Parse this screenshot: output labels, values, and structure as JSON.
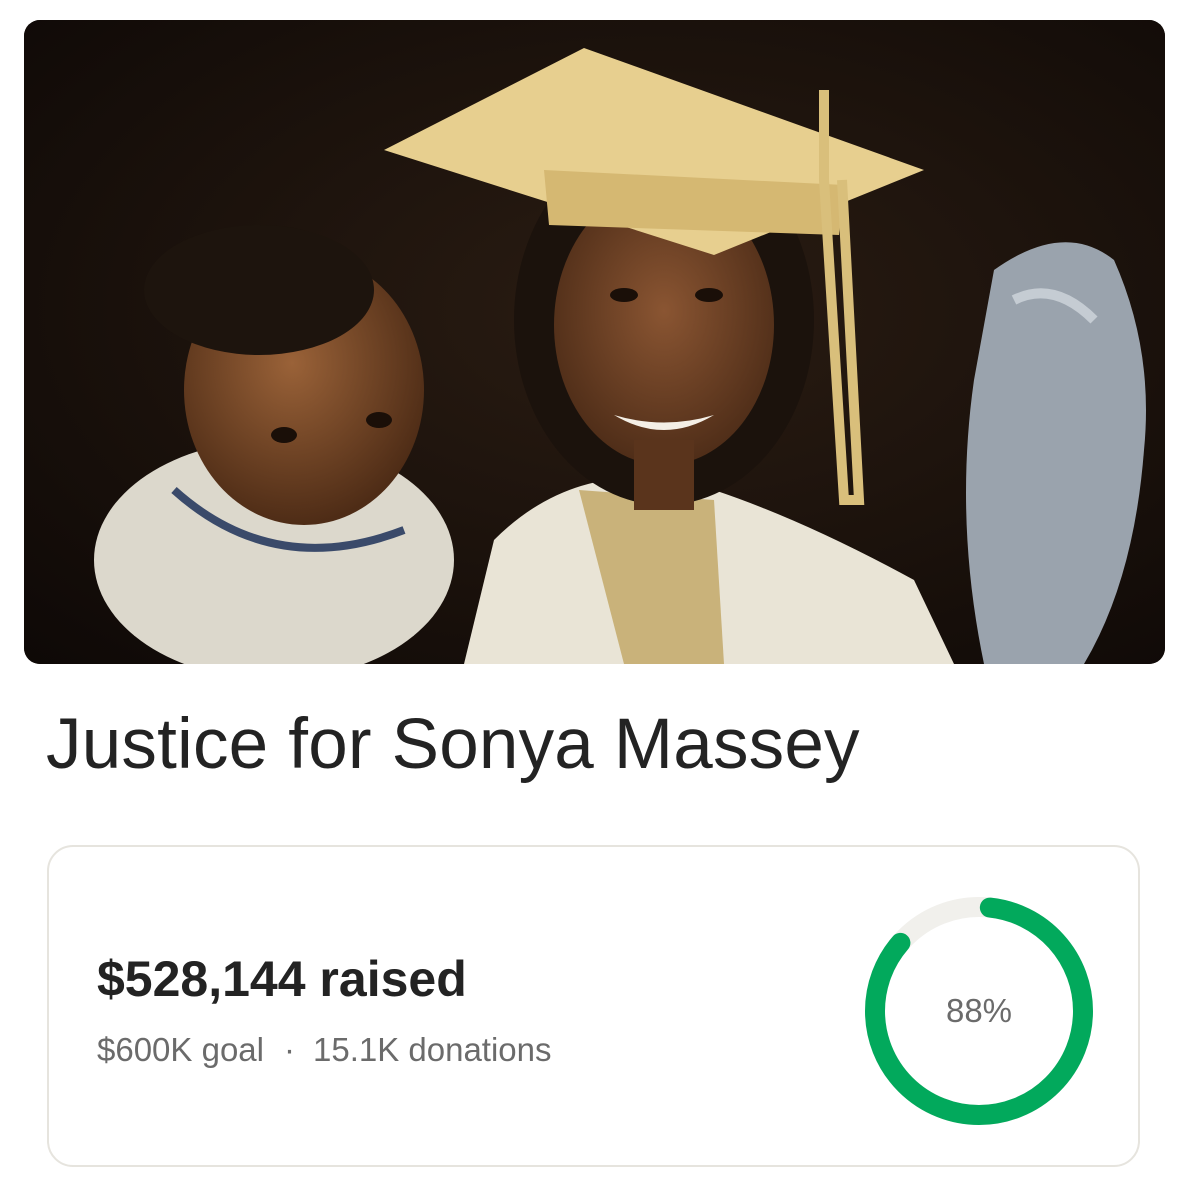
{
  "campaign": {
    "title": "Justice for Sonya Massey",
    "raised_label": "$528,144 raised",
    "goal_label": "$600K goal",
    "separator": "·",
    "donations_label": "15.1K donations",
    "progress_label": "88%",
    "progress_fraction": 0.88
  },
  "colors": {
    "progress_fill": "#02a95c",
    "progress_track": "#f1f0ec",
    "card_border": "#e6e4de"
  }
}
